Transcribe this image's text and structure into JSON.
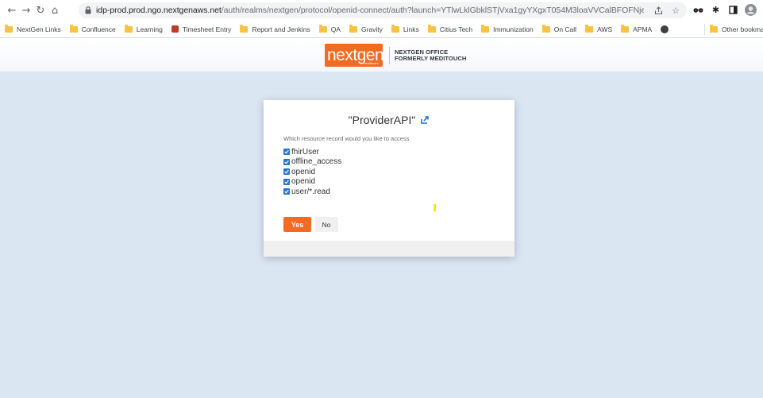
{
  "browser": {
    "url_host": "idp-prod.prod.ngo.nextgenaws.net",
    "url_path": "/auth/realms/nextgen/protocol/openid-connect/auth?launch=YTlwLklGbklSTjVxa1gyYXgxT054M3loaVVCalBFOFNjemczdkdaY0pTUGRBSE5NNW..."
  },
  "bookmarks": {
    "items": [
      {
        "label": "NextGen Links",
        "icon": "folder-icon"
      },
      {
        "label": "Confluence",
        "icon": "folder-icon"
      },
      {
        "label": "Learning",
        "icon": "folder-icon"
      },
      {
        "label": "Timesheet Entry",
        "icon": "timesheet-icon"
      },
      {
        "label": "Report and Jenkins",
        "icon": "folder-icon"
      },
      {
        "label": "QA",
        "icon": "folder-icon"
      },
      {
        "label": "Gravity",
        "icon": "folder-icon"
      },
      {
        "label": "Links",
        "icon": "folder-icon"
      },
      {
        "label": "Citius Tech",
        "icon": "folder-icon"
      },
      {
        "label": "Immunization",
        "icon": "folder-icon"
      },
      {
        "label": "On Call",
        "icon": "folder-icon"
      },
      {
        "label": "AWS",
        "icon": "folder-icon"
      },
      {
        "label": "APMA",
        "icon": "folder-icon"
      },
      {
        "label": "",
        "icon": "globe-icon"
      }
    ],
    "other": "Other bookmarks"
  },
  "header": {
    "logo_word": "nextgen.",
    "logo_sub": "healthcare",
    "logo_line1": "NEXTGEN OFFICE",
    "logo_line2": "FORMERLY MEDITOUCH"
  },
  "consent": {
    "title": "\"ProviderAPI\"",
    "subtitle": "Which resource record would you like to access",
    "scopes": [
      "fhirUser",
      "offline_access",
      "openid",
      "openid",
      "user/*.read"
    ],
    "yes_label": "Yes",
    "no_label": "No"
  },
  "colors": {
    "accent": "#f26b21",
    "checkbox": "#2a74c9",
    "page_bg": "#dbe6f3"
  }
}
